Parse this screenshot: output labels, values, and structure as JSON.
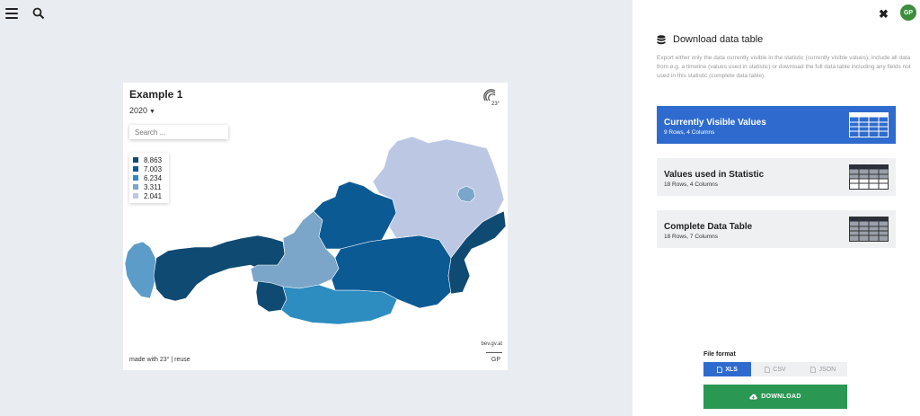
{
  "topbar": {
    "menu_icon": "hamburger-menu-icon",
    "search_icon": "search-icon"
  },
  "card": {
    "title": "Example 1",
    "year": "2020",
    "search_placeholder": "Search ...",
    "legend": [
      {
        "label": "8.863",
        "color": "#0f4a72"
      },
      {
        "label": "7.003",
        "color": "#0c5a94"
      },
      {
        "label": "6.234",
        "color": "#2d8cc0"
      },
      {
        "label": "3.311",
        "color": "#7ba6c9"
      },
      {
        "label": "2.041",
        "color": "#bcc8e3"
      }
    ],
    "attribution": "bev.gv.at",
    "made_with": "made with 23° |",
    "reuse": "reuse",
    "gp": "GP"
  },
  "panel": {
    "avatar": "GP",
    "title": "Download data table",
    "description": "Export either only the data currently visible in the statistic (currently visible values), include all data from e.g. a timeline (values used in statistic) or download the full data table including any fields not used in this statistic (complete data table).",
    "options": [
      {
        "title": "Currently Visible Values",
        "sub": "9 Rows, 4 Columns"
      },
      {
        "title": "Values used in Statistic",
        "sub": "18 Rows, 4 Columns"
      },
      {
        "title": "Complete Data Table",
        "sub": "18 Rows, 7 Columns"
      }
    ],
    "file_format_label": "File format",
    "formats": [
      "XLS",
      "CSV",
      "JSON"
    ],
    "download_label": "DOWNLOAD"
  }
}
